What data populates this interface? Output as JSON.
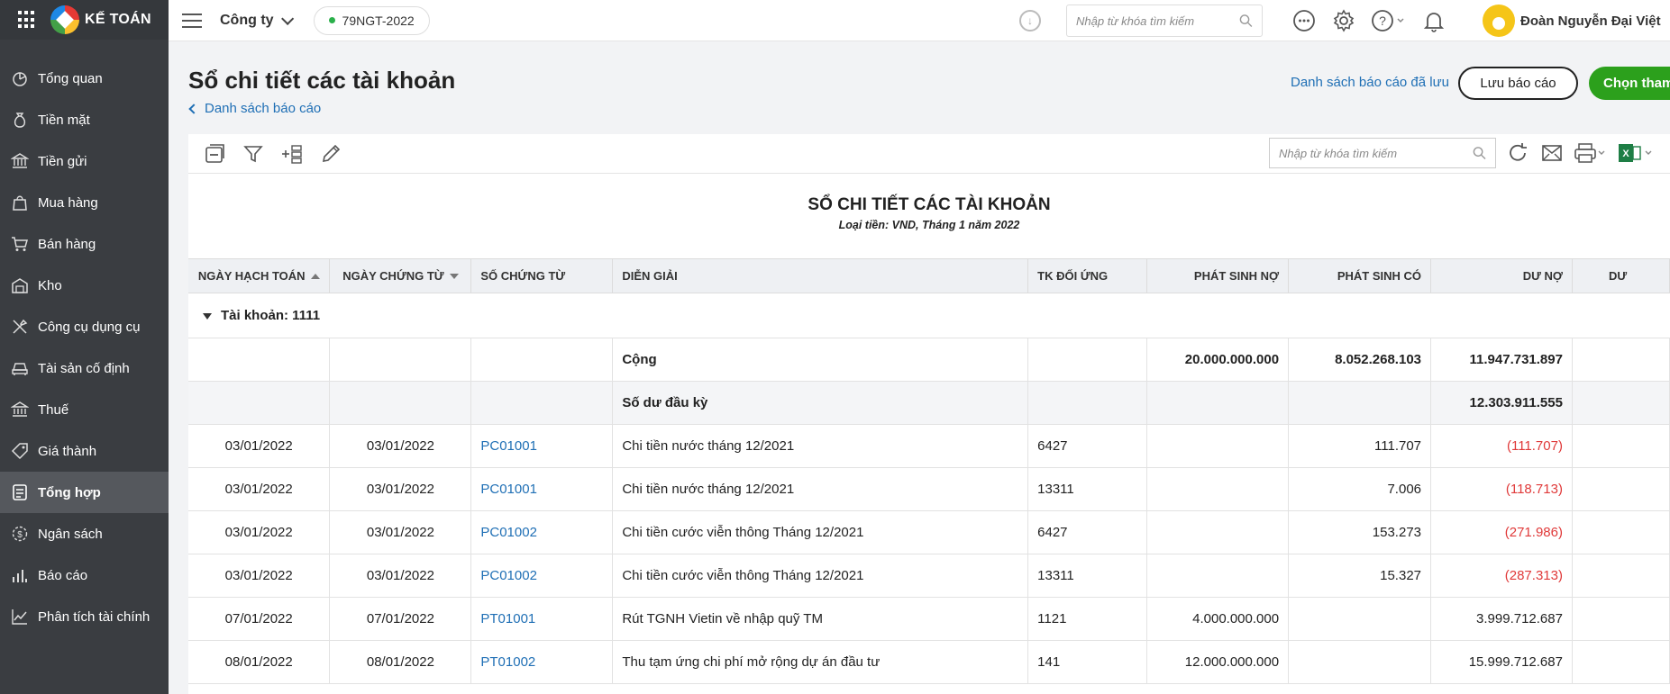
{
  "app": {
    "brand": "KẾ TOÁN"
  },
  "sidebar": {
    "items": [
      {
        "label": "Tổng quan",
        "icon": "pie-chart-icon"
      },
      {
        "label": "Tiền mặt",
        "icon": "money-bag-icon"
      },
      {
        "label": "Tiền gửi",
        "icon": "bank-icon"
      },
      {
        "label": "Mua hàng",
        "icon": "shopping-bag-icon"
      },
      {
        "label": "Bán hàng",
        "icon": "cart-icon"
      },
      {
        "label": "Kho",
        "icon": "warehouse-icon"
      },
      {
        "label": "Công cụ dụng cụ",
        "icon": "tools-icon"
      },
      {
        "label": "Tài sản cố định",
        "icon": "car-icon"
      },
      {
        "label": "Thuế",
        "icon": "government-icon"
      },
      {
        "label": "Giá thành",
        "icon": "price-tag-icon"
      },
      {
        "label": "Tổng hợp",
        "icon": "ledger-icon",
        "active": true
      },
      {
        "label": "Ngân sách",
        "icon": "budget-icon"
      },
      {
        "label": "Báo cáo",
        "icon": "bar-chart-icon"
      },
      {
        "label": "Phân tích tài chính",
        "icon": "trend-chart-icon"
      }
    ]
  },
  "topbar": {
    "company": "Công ty",
    "database": "79NGT-2022",
    "search_placeholder": "Nhập từ khóa tìm kiếm",
    "user_name": "Đoàn Nguyễn Đại Việt"
  },
  "page": {
    "title": "Sổ chi tiết các tài khoản",
    "back_link": "Danh sách báo cáo",
    "saved_reports_link": "Danh sách báo cáo đã lưu",
    "save_button": "Lưu báo cáo",
    "primary_button": "Chọn tham"
  },
  "toolbar": {
    "search_placeholder": "Nhập từ khóa tìm kiếm"
  },
  "report": {
    "title": "SỔ CHI TIẾT CÁC TÀI KHOẢN",
    "subtitle": "Loại tiền: VND, Tháng 1 năm 2022",
    "columns": {
      "posting_date": "NGÀY HẠCH TOÁN",
      "doc_date": "NGÀY CHỨNG TỪ",
      "doc_no": "SỐ CHỨNG TỪ",
      "description": "DIỄN GIẢI",
      "contra_account": "TK ĐỐI ỨNG",
      "debit": "PHÁT SINH NỢ",
      "credit": "PHÁT SINH CÓ",
      "debit_balance": "DƯ NỢ",
      "credit_balance": "DƯ"
    },
    "group_label": "Tài khoản: 1111",
    "total_row": {
      "label": "Cộng",
      "debit": "20.000.000.000",
      "credit": "8.052.268.103",
      "debit_balance": "11.947.731.897"
    },
    "opening_row": {
      "label": "Số dư đầu kỳ",
      "debit_balance": "12.303.911.555"
    },
    "rows": [
      {
        "posting_date": "03/01/2022",
        "doc_date": "03/01/2022",
        "doc_no": "PC01001",
        "description": "Chi tiền nước tháng 12/2021",
        "contra": "6427",
        "debit": "",
        "credit": "111.707",
        "balance": "(111.707)",
        "negative": true
      },
      {
        "posting_date": "03/01/2022",
        "doc_date": "03/01/2022",
        "doc_no": "PC01001",
        "description": "Chi tiền nước tháng 12/2021",
        "contra": "13311",
        "debit": "",
        "credit": "7.006",
        "balance": "(118.713)",
        "negative": true
      },
      {
        "posting_date": "03/01/2022",
        "doc_date": "03/01/2022",
        "doc_no": "PC01002",
        "description": "Chi tiền cước viễn thông Tháng 12/2021",
        "contra": "6427",
        "debit": "",
        "credit": "153.273",
        "balance": "(271.986)",
        "negative": true
      },
      {
        "posting_date": "03/01/2022",
        "doc_date": "03/01/2022",
        "doc_no": "PC01002",
        "description": "Chi tiền cước viễn thông Tháng 12/2021",
        "contra": "13311",
        "debit": "",
        "credit": "15.327",
        "balance": "(287.313)",
        "negative": true
      },
      {
        "posting_date": "07/01/2022",
        "doc_date": "07/01/2022",
        "doc_no": "PT01001",
        "description": "Rút TGNH Vietin về nhập quỹ TM",
        "contra": "1121",
        "debit": "4.000.000.000",
        "credit": "",
        "balance": "3.999.712.687",
        "negative": false
      },
      {
        "posting_date": "08/01/2022",
        "doc_date": "08/01/2022",
        "doc_no": "PT01002",
        "description": "Thu tạm ứng chi phí mở rộng dự án đầu tư",
        "contra": "141",
        "debit": "12.000.000.000",
        "credit": "",
        "balance": "15.999.712.687",
        "negative": false
      }
    ]
  },
  "colors": {
    "sidebar_bg": "#3a3d41",
    "primary_green": "#2ca01c",
    "link_blue": "#1f6fb5",
    "negative_red": "#e03a3a"
  }
}
